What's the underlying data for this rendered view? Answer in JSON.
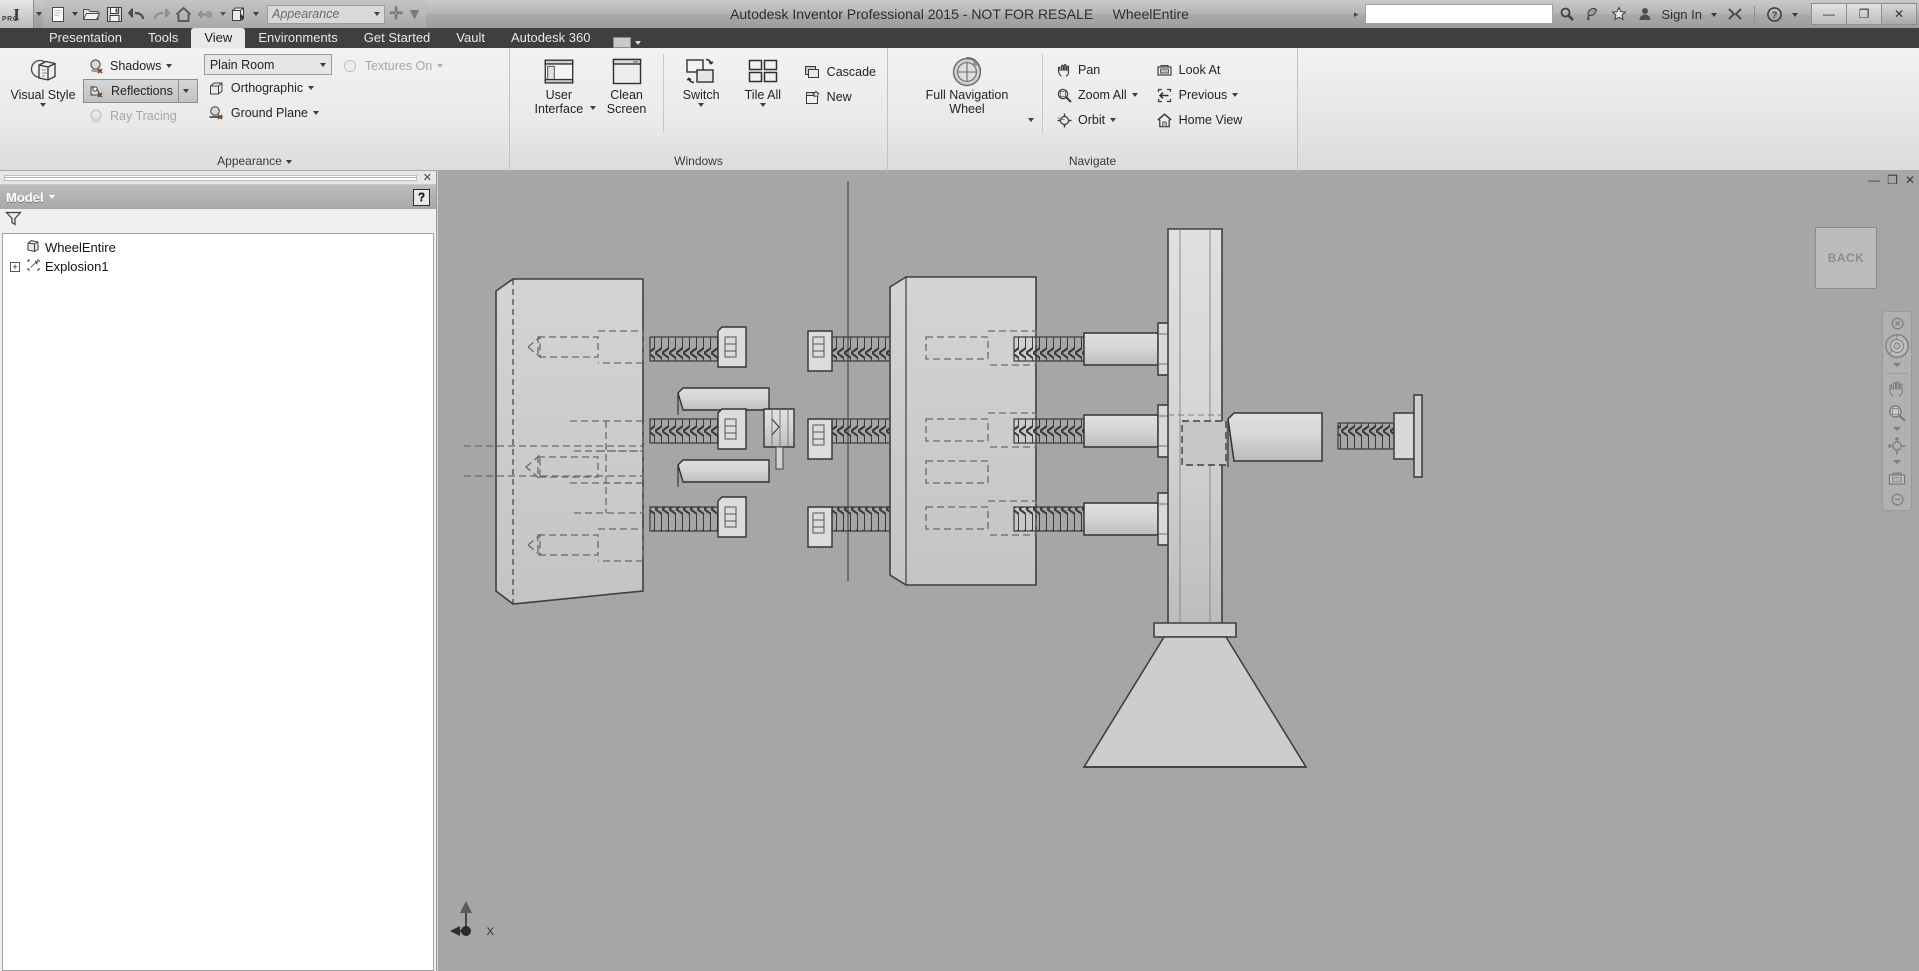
{
  "window": {
    "title": "Autodesk Inventor Professional 2015 - NOT FOR RESALE",
    "document_name": "WheelEntire",
    "app_logo": "I",
    "pro_tag": "PRO",
    "minimize": "—",
    "restore": "❐",
    "close": "✕"
  },
  "quick_access": {
    "items": [
      {
        "name": "new-file",
        "glyph": "🗋"
      },
      {
        "name": "open-file",
        "glyph": "🗁"
      },
      {
        "name": "save",
        "glyph": "💾"
      },
      {
        "name": "undo",
        "glyph": "↩"
      },
      {
        "name": "redo",
        "glyph": "↪"
      },
      {
        "name": "home",
        "glyph": "⌂"
      },
      {
        "name": "return",
        "glyph": "⬅"
      },
      {
        "name": "appearance-box",
        "glyph": "◰"
      }
    ],
    "appearance_value": "Appearance",
    "customize_plus": "✛",
    "customize_menu": "▾"
  },
  "title_right": {
    "search_value": "",
    "search_placeholder": "",
    "icons": [
      {
        "name": "search-icon",
        "glyph": "🔍"
      },
      {
        "name": "communication-center-icon",
        "glyph": "📡"
      },
      {
        "name": "favorites-star-icon",
        "glyph": "★"
      }
    ],
    "sign_in": "Sign In",
    "exchange": "✖",
    "help": "?"
  },
  "ribbon_tabs": {
    "items": [
      {
        "label": "Presentation",
        "active": false
      },
      {
        "label": "Tools",
        "active": false
      },
      {
        "label": "View",
        "active": true
      },
      {
        "label": "Environments",
        "active": false
      },
      {
        "label": "Get Started",
        "active": false
      },
      {
        "label": "Vault",
        "active": false
      },
      {
        "label": "Autodesk 360",
        "active": false
      }
    ],
    "overflow_caret": "▾"
  },
  "ribbon": {
    "panels": [
      {
        "title": "Appearance",
        "title_caret": "▾",
        "big_buttons": [
          {
            "label_line1": "Visual Style",
            "label_line2": "",
            "icon": "visual-style-icon",
            "caret": "▾"
          }
        ],
        "items": [
          {
            "label": "Shadows",
            "icon": "shadows-icon",
            "caret": "▾",
            "state": "normal"
          },
          {
            "label": "Reflections",
            "icon": "reflections-icon",
            "caret": "▾",
            "state": "toggled"
          },
          {
            "label": "Ray Tracing",
            "icon": "ray-tracing-icon",
            "caret": "",
            "state": "disabled"
          },
          {
            "label": "Orthographic",
            "icon": "orthographic-icon",
            "caret": "▾",
            "state": "normal"
          },
          {
            "label": "Ground Plane",
            "icon": "ground-plane-icon",
            "caret": "▾",
            "state": "normal"
          },
          {
            "label": "Textures On",
            "icon": "textures-icon",
            "caret": "▾",
            "state": "disabled"
          }
        ],
        "combo_value": "Plain Room",
        "combo_caret": "▾"
      },
      {
        "title": "Windows",
        "title_caret": "",
        "big_buttons": [
          {
            "label_line1": "User",
            "label_line2": "Interface",
            "icon": "user-interface-icon",
            "caret": "▾"
          },
          {
            "label_line1": "Clean",
            "label_line2": "Screen",
            "icon": "clean-screen-icon",
            "caret": ""
          },
          {
            "label_line1": "Switch",
            "label_line2": "",
            "icon": "switch-windows-icon",
            "caret": "▾"
          },
          {
            "label_line1": "Tile All",
            "label_line2": "",
            "icon": "tile-all-icon",
            "caret": "▾"
          }
        ],
        "items": [
          {
            "label": "Cascade",
            "icon": "cascade-icon",
            "caret": "",
            "state": "normal"
          },
          {
            "label": "New",
            "icon": "new-window-icon",
            "caret": "",
            "state": "normal"
          }
        ]
      },
      {
        "title": "Navigate",
        "title_caret": "",
        "big_buttons": [
          {
            "label_line1": "Full Navigation",
            "label_line2": "Wheel",
            "icon": "navigation-wheel-icon",
            "caret": "▾"
          }
        ],
        "items": [
          {
            "label": "Pan",
            "icon": "pan-hand-icon",
            "caret": "",
            "state": "normal"
          },
          {
            "label": "Zoom All",
            "icon": "zoom-all-icon",
            "caret": "▾",
            "state": "normal"
          },
          {
            "label": "Orbit",
            "icon": "orbit-icon",
            "caret": "▾",
            "state": "normal"
          },
          {
            "label": "Look At",
            "icon": "look-at-icon",
            "caret": "",
            "state": "normal"
          },
          {
            "label": "Previous",
            "icon": "previous-view-icon",
            "caret": "▾",
            "state": "normal"
          },
          {
            "label": "Home View",
            "icon": "home-view-icon",
            "caret": "",
            "state": "normal"
          }
        ]
      }
    ]
  },
  "browser": {
    "panel_title": "Model",
    "panel_caret": "▾",
    "close_glyph": "✕",
    "help_glyph": "?",
    "filter_icon": "filter-icon",
    "tree": [
      {
        "label": "WheelEntire",
        "icon": "assembly-icon",
        "level": 0,
        "expander": ""
      },
      {
        "label": "Explosion1",
        "icon": "explosion-icon",
        "level": 1,
        "expander": "+"
      }
    ]
  },
  "viewport": {
    "doc_controls": [
      {
        "name": "doc-minimize",
        "glyph": "—"
      },
      {
        "name": "doc-restore",
        "glyph": "❐"
      },
      {
        "name": "doc-close",
        "glyph": "✕"
      }
    ],
    "viewcube_label": "BACK",
    "navbar": [
      {
        "name": "navbar-close-icon",
        "glyph": "⊗"
      },
      {
        "name": "navigation-wheel-icon",
        "glyph": "◎"
      },
      {
        "name": "pan-hand-icon",
        "glyph": "✋"
      },
      {
        "name": "zoom-icon",
        "glyph": "🔍"
      },
      {
        "name": "orbit-icon",
        "glyph": "✥"
      },
      {
        "name": "look-at-icon",
        "glyph": "▣"
      },
      {
        "name": "navbar-options-icon",
        "glyph": "⊖"
      }
    ],
    "axis_label_x": "X",
    "background_color": "#a6a6a6"
  },
  "colors": {
    "viewport_bg": "#a6a6a6",
    "part_fill": "#c9c9c9",
    "part_fill_light": "#d2d2d2",
    "part_edge": "#4b4b4b",
    "hidden_edge": "#6e6e6e",
    "thread_dark": "#3a3a3a",
    "ribbon_bg": "#ebebeb",
    "tab_bar": "#3f3f3f"
  }
}
